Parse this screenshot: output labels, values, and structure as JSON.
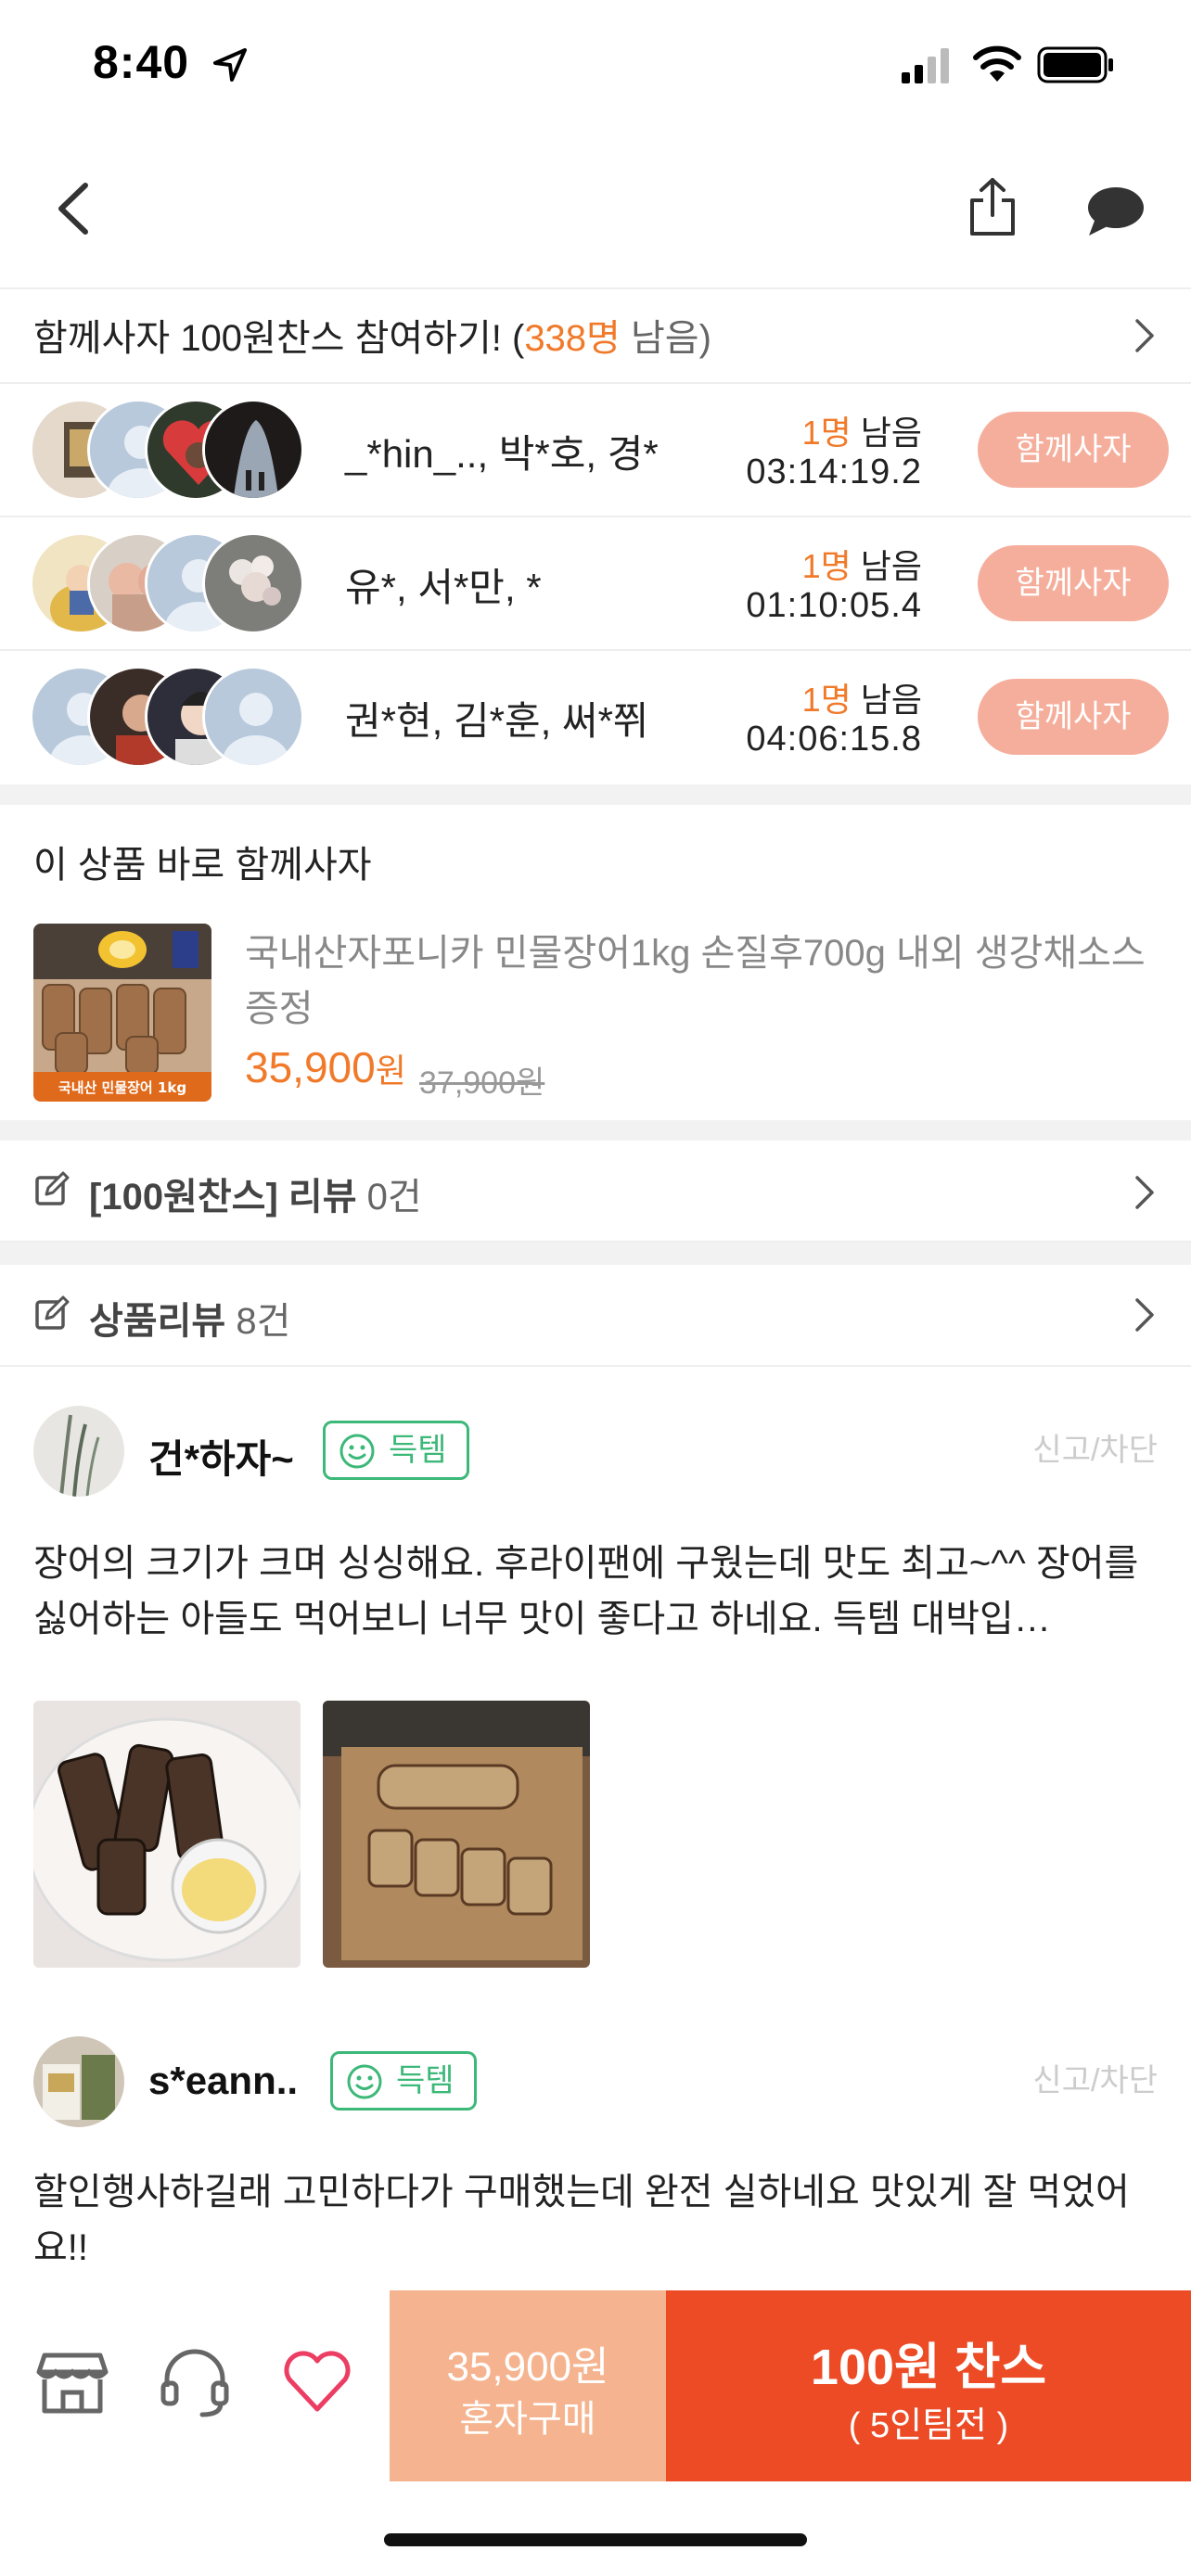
{
  "status": {
    "time": "8:40"
  },
  "group": {
    "header_prefix": "함께사자 100원찬스 참여하기! (",
    "header_count": "338명",
    "header_suffix": " 남음)",
    "rows": [
      {
        "members": "_*hin_.., 박*호, 경*",
        "remain_count": "1명",
        "remain_label": " 남음",
        "timer": "03:14:19.2",
        "button": "함께사자"
      },
      {
        "members": "유*, 서*만, *",
        "remain_count": "1명",
        "remain_label": " 남음",
        "timer": "01:10:05.4",
        "button": "함께사자"
      },
      {
        "members": "권*현, 김*훈, 써*쮜",
        "remain_count": "1명",
        "remain_label": " 남음",
        "timer": "04:06:15.8",
        "button": "함께사자"
      }
    ]
  },
  "product": {
    "section_title": "이 상품 바로 함께사자",
    "thumb_label": "국내산 민물장어 1kg",
    "name": "국내산자포니카 민물장어1kg 손질후700g 내외 생강채소스증정",
    "price": "35,900",
    "price_unit": "원",
    "original_price": "37,900원"
  },
  "links": {
    "chance_review_label": "[100원찬스] 리뷰",
    "chance_review_count": " 0건",
    "product_review_label": "상품리뷰",
    "product_review_count": " 8건"
  },
  "reviews": [
    {
      "name": "건*하자~",
      "badge": "득템",
      "report": "신고/차단",
      "text": "장어의 크기가 크며 싱싱해요. 후라이팬에 구웠는데 맛도 최고~^^ 장어를 싫어하는 아들도 먹어보니 너무 맛이 좋다고 하네요. 득템 대박입…"
    },
    {
      "name": "s*eann..",
      "badge": "득템",
      "report": "신고/차단",
      "text": "할인행사하길래 고민하다가 구매했는데 완전 실하네요 맛있게 잘 먹었어요!!"
    }
  ],
  "bottom": {
    "solo_price": "35,900원",
    "solo_label": "혼자구매",
    "chance_title": "100원 찬스",
    "chance_sub": "( 5인팀전 )"
  },
  "colors": {
    "accent": "#f07a2a",
    "chance": "#ec4b26",
    "solo": "#f5b48f",
    "join": "#f5ae9c",
    "badge": "#3cb878"
  }
}
